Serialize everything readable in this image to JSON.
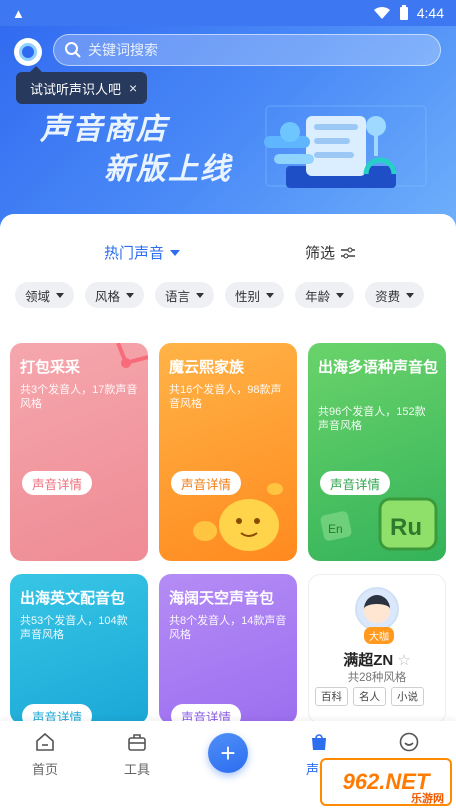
{
  "status_bar": {
    "time": "4:44"
  },
  "search": {
    "placeholder": "关键词搜索"
  },
  "tooltip": {
    "text": "试试听声识人吧",
    "close": "×"
  },
  "banner": {
    "line1": "声音商店",
    "line2": "新版上线"
  },
  "tabs": {
    "hot": "热门声音",
    "filter": "筛选"
  },
  "chips": [
    "领域",
    "风格",
    "语言",
    "性别",
    "年龄",
    "资费"
  ],
  "cards": [
    {
      "title": "打包采采",
      "desc": "共3个发音人，17款声音风格",
      "button": "声音详情"
    },
    {
      "title": "魔云熙家族",
      "desc": "共16个发音人，98款声音风格",
      "button": "声音详情"
    },
    {
      "title": "出海多语种声音包",
      "desc": "共96个发音人，152款声音风格",
      "button": "声音详情"
    },
    {
      "title": "出海英文配音包",
      "desc": "共53个发音人，104款声音风格",
      "button": "声音详情"
    },
    {
      "title": "海阔天空声音包",
      "desc": "共8个发音人，14款声音风格",
      "button": "声音详情"
    }
  ],
  "voice_card": {
    "badge": "大咖",
    "name": "满超ZN",
    "sub": "共28种风格",
    "tags": [
      "百科",
      "名人",
      "小说"
    ]
  },
  "bottom_nav": {
    "home": "首页",
    "tools": "工具",
    "voice": "声音",
    "mine": "我的"
  },
  "watermark": {
    "text": "962.NET",
    "sub": "乐游网"
  },
  "colors": {
    "accent": "#2d6df0",
    "banner": "#3d77f2"
  }
}
